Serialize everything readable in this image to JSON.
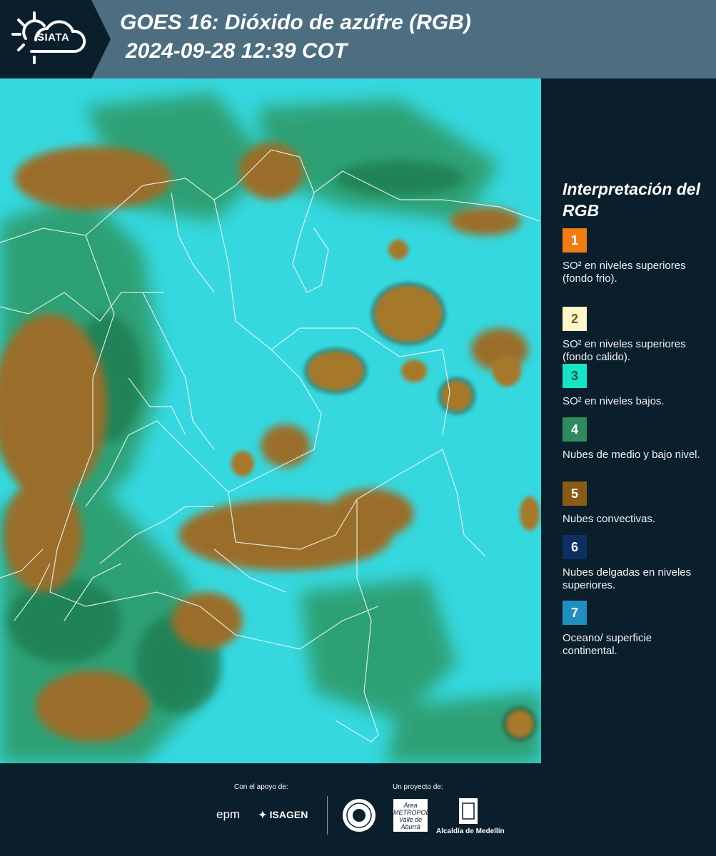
{
  "header": {
    "logo_text": "SIATA",
    "title": "GOES 16: Dióxido de azúfre (RGB)",
    "subtitle": "2024-09-28 12:39 COT"
  },
  "legend": {
    "title": "Interpretación del RGB",
    "items": [
      {
        "number": "1",
        "label": "SO² en niveles superiores (fondo frio).",
        "color": "#f07d14",
        "text_color": "#ffffff"
      },
      {
        "number": "2",
        "label": "SO² en niveles superiores (fondo calido).",
        "color": "#fff5c6",
        "text_color": "#6b5a2a"
      },
      {
        "number": "3",
        "label": "SO² en niveles bajos.",
        "color": "#17e3c6",
        "text_color": "#0f5a55"
      },
      {
        "number": "4",
        "label": "Nubes de medio y bajo nivel.",
        "color": "#2f8a5e",
        "text_color": "#ffffff"
      },
      {
        "number": "5",
        "label": "Nubes convectivas.",
        "color": "#8a5a16",
        "text_color": "#ffffff"
      },
      {
        "number": "6",
        "label": "Nubes delgadas en niveles superiores.",
        "color": "#0d2f63",
        "text_color": "#ffffff"
      },
      {
        "number": "7",
        "label": "Oceano/ superficie continental.",
        "color": "#1e8fbf",
        "text_color": "#ffffff"
      }
    ]
  },
  "footer": {
    "support_label": "Con el apoyo de:",
    "project_label": "Un proyecto de:",
    "epm": "epm",
    "isagen": "ISAGEN",
    "area_metro": "Área METROPOLITANA Valle de Aburrá",
    "alcaldia": "Alcaldía de Medellín"
  }
}
